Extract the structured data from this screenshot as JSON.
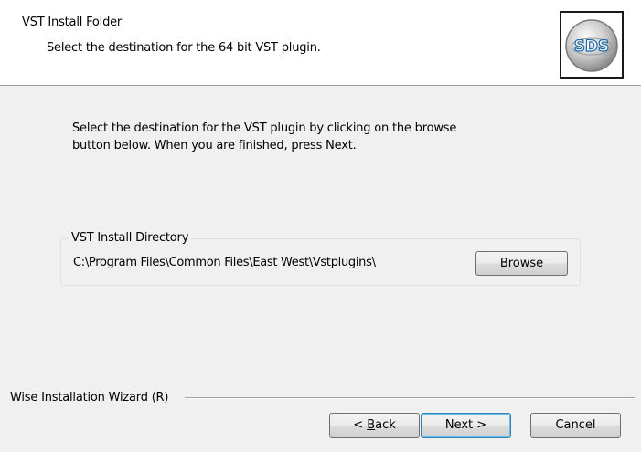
{
  "header": {
    "title": "VST Install Folder",
    "subtitle": "Select the destination for the 64 bit VST plugin.",
    "logo_text": "SDS",
    "logo_icon": "sds-logo-icon"
  },
  "main": {
    "instructions_line1": "Select the destination for the VST plugin by clicking on the browse",
    "instructions_line2": "button below. When you are finished, press Next.",
    "group": {
      "label": "VST Install Directory",
      "path": "C:\\Program Files\\Common Files\\East West\\Vstplugins\\",
      "browse": {
        "accel": "B",
        "rest": "rowse"
      }
    }
  },
  "footer": {
    "wizard_label": "Wise Installation Wizard (R)",
    "back": {
      "prefix": "< ",
      "accel": "B",
      "rest": "ack"
    },
    "next_label": "Next >",
    "cancel_label": "Cancel"
  },
  "colors": {
    "window_bg": "#f0f0f0",
    "header_bg": "#ffffff",
    "default_button_border": "#3c7fb1"
  }
}
